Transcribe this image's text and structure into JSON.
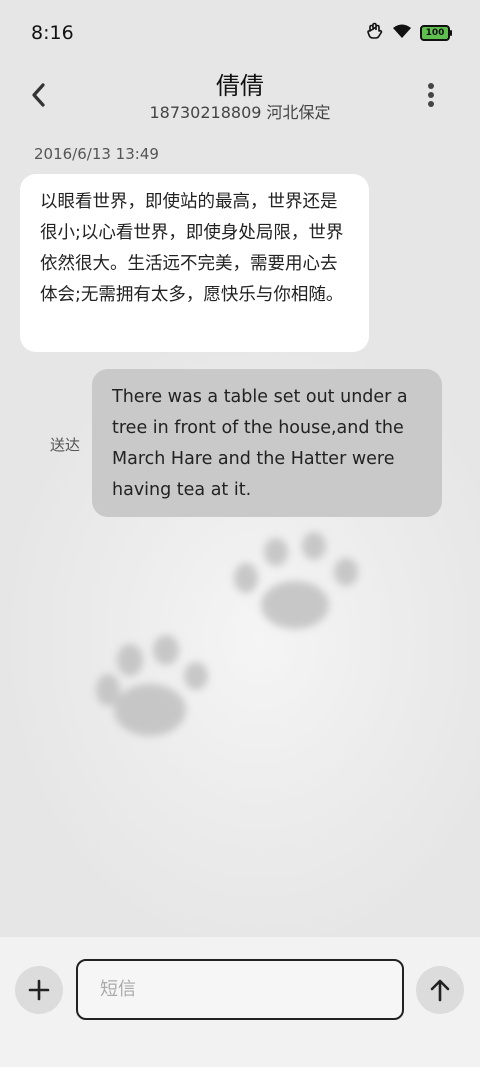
{
  "status_bar": {
    "time": "8:16",
    "battery": "100",
    "icons": [
      "hand-gesture-icon",
      "wifi-icon",
      "battery-icon"
    ]
  },
  "header": {
    "back_icon": "back-chevron-icon",
    "contact_name": "倩倩",
    "contact_detail": "18730218809 河北保定",
    "more_icon": "more-vertical-icon"
  },
  "messages": [
    {
      "timestamp": "2016/6/13 13:49",
      "direction": "incoming",
      "text": "以眼看世界，即使站的最高，世界还是很小;以心看世界，即使身处局限，世界依然很大。生活远不完美，需要用心去体会;无需拥有太多，愿快乐与你相随。"
    },
    {
      "direction": "outgoing",
      "status": "送达",
      "text": "There was a table set out under a tree in front of the house,and the March Hare and the Hatter were having tea at it."
    }
  ],
  "composer": {
    "add_icon": "plus-icon",
    "placeholder": "短信",
    "value": "",
    "send_icon": "arrow-up-icon"
  },
  "colors": {
    "incoming_bubble": "#ffffff",
    "outgoing_bubble": "#c9c9c9",
    "background": "#e7e7e7",
    "battery_fill": "#5fbf4f"
  }
}
